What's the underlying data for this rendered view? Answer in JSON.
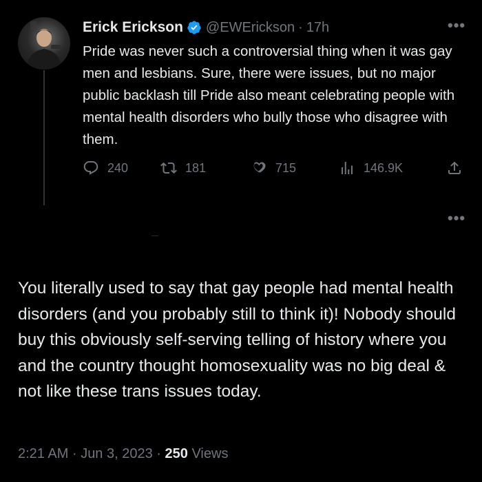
{
  "quoted_tweet": {
    "author_name": "Erick Erickson",
    "handle": "@EWErickson",
    "separator": "·",
    "age": "17h",
    "body": "Pride was never such a controversial thing when it was gay men and lesbians. Sure, there were issues, but no major public backlash till Pride also meant celebrating people with mental health disorders who bully those who disagree with them.",
    "replies": "240",
    "retweets": "181",
    "likes": "715",
    "views": "146.9K",
    "more_label": "•••"
  },
  "reply": {
    "more_label": "•••",
    "body": "You literally used to say that gay people had mental health disorders (and you probably still to think it)! Nobody should buy this obviously self-serving telling of history where you and the country thought homosexuality was no big deal & not like these trans issues today.",
    "time": "2:21 AM",
    "date": "Jun 3, 2023",
    "separator": "·",
    "view_count": "250",
    "views_label": "Views"
  },
  "colors": {
    "background": "#000000",
    "text": "#e7e9ea",
    "muted": "#71767b",
    "verified": "#1d9bf0"
  },
  "icons": [
    "reply-icon",
    "retweet-icon",
    "like-icon",
    "views-icon",
    "share-icon",
    "verified-badge-icon",
    "more-icon"
  ]
}
